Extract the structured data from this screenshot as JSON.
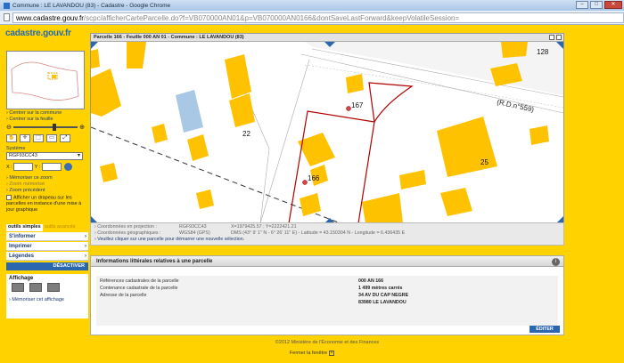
{
  "browser": {
    "window_title": "Commune : LE LAVANDOU (83) - Cadastre - Google Chrome",
    "url_host": "www.cadastre.gouv.fr",
    "url_path": "/scpc/afficherCarteParcelle.do?f=VB070000AN01&p=VB070000AN0166&dontSaveLastForward&keepVolatileSession="
  },
  "brand": {
    "logo": "cadastre.gouv.fr"
  },
  "left": {
    "links": [
      "› Centrer sur la commune",
      "› Centrer sur la feuille"
    ],
    "system_label": "Système",
    "system_value": "RGF93CC43",
    "x_label": "X :",
    "y_label": "Y :",
    "memo_zoom": "› Mémoriser ce zoom",
    "zoom_memorized": "› Zoom mémorisé",
    "zoom_previous": "› Zoom précédent",
    "flag_text": "Afficher un drapeau sur les parcelles en instance d'une mise à jour graphique",
    "tab_simple": "outils simples",
    "tab_advanced": "outils avancés",
    "tool_inform": "S'informer",
    "tool_print": "Imprimer",
    "tool_legend": "Légendes",
    "deactivate": "DÉSACTIVER",
    "affichage_title": "Affichage",
    "memo_affichage": "› Mémoriser cet affichage"
  },
  "map": {
    "title": "Parcelle 166 - Feuille 000 AN 01 - Commune : LE LAVANDOU (83)",
    "labels": {
      "p167": "167",
      "p166": "166",
      "p22": "22",
      "p25": "25",
      "p128": "128",
      "road": "(R.D.n°559)"
    }
  },
  "coords": {
    "proj_label": "› Coordonnées en projection :",
    "proj_system": "RGF93CC43",
    "proj_value": "X=1979425.57 ; Y=2222421.21",
    "geo_label": "› Coordonnées géographiques :",
    "geo_system": "WGS84 (GPS)",
    "geo_value": "DMS (43° 9' 1'' N - 6° 26' 11'' E) - Latitude = 43.150304 N - Longitude = 6.436435 E",
    "hint": "› Veuillez cliquer sur une parcelle pour démarrer une nouvelle sélection."
  },
  "info": {
    "title": "Informations littérales relatives à une parcelle",
    "rows": [
      {
        "label": "Références cadastrales de la parcelle",
        "value": "000 AN 166"
      },
      {
        "label": "Contenance cadastrale de la parcelle",
        "value": "1 499 mètres carrés"
      },
      {
        "label": "Adresse de la parcelle",
        "value": "34 AV DU CAP NEGRE"
      },
      {
        "label": "",
        "value": "83980 LE LAVANDOU"
      }
    ],
    "edit": "ÉDITER"
  },
  "footer": {
    "copyright": "©2012 Ministère de l'Économie et des Finances",
    "close": "Fermer la fenêtre"
  },
  "colors": {
    "brand_yellow": "#ffd200",
    "building": "#ffc200",
    "parcel_outline": "#b40000",
    "accent_blue": "#2b67ae"
  }
}
